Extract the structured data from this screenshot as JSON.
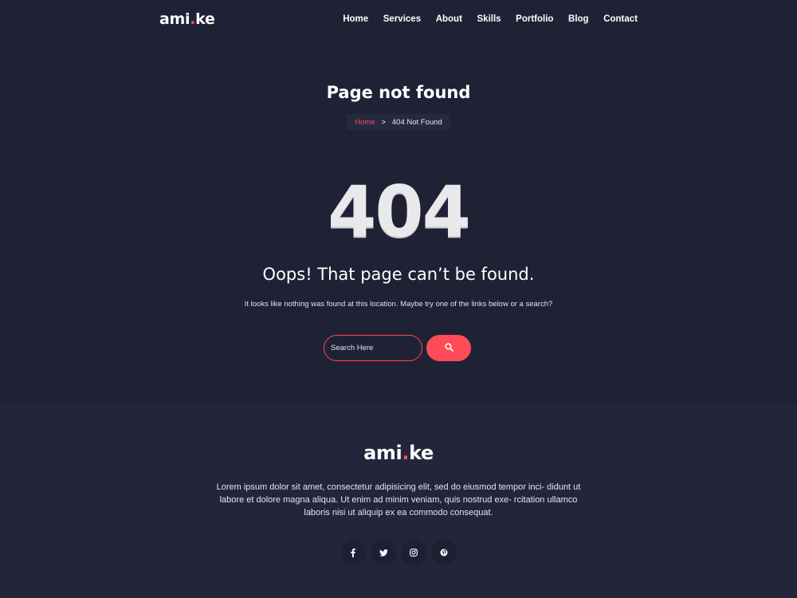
{
  "header": {
    "logo": {
      "prefix": "ami",
      "dot": ".",
      "suffix": "ke"
    },
    "nav": [
      "Home",
      "Services",
      "About",
      "Skills",
      "Portfolio",
      "Blog",
      "Contact"
    ]
  },
  "banner": {
    "title": "Page not found",
    "breadcrumb": {
      "home": "Home",
      "separator": ">",
      "current": "404 Not Found"
    }
  },
  "error": {
    "code": "404",
    "heading": "Oops! That page can’t be found.",
    "description": "It looks like nothing was found at this location. Maybe try one of the links below or a search?"
  },
  "search": {
    "placeholder": "Search Here",
    "value": "",
    "button_icon": "search-icon"
  },
  "footer": {
    "logo": {
      "prefix": "ami",
      "dot": ".",
      "suffix": "ke"
    },
    "text": "Lorem ipsum dolor sit amet, consectetur adipisicing elit, sed do eiusmod tempor inci- didunt ut labore et dolore magna aliqua. Ut enim ad minim veniam, quis nostrud exe- rcitation ullamco laboris nisi ut aliquip ex ea commodo consequat.",
    "socials": [
      "facebook-icon",
      "twitter-icon",
      "instagram-icon",
      "pinterest-icon"
    ]
  },
  "colors": {
    "background": "#1f2235",
    "footer": "#23263b",
    "accent": "#ff4a57",
    "text": "#ffffff"
  }
}
